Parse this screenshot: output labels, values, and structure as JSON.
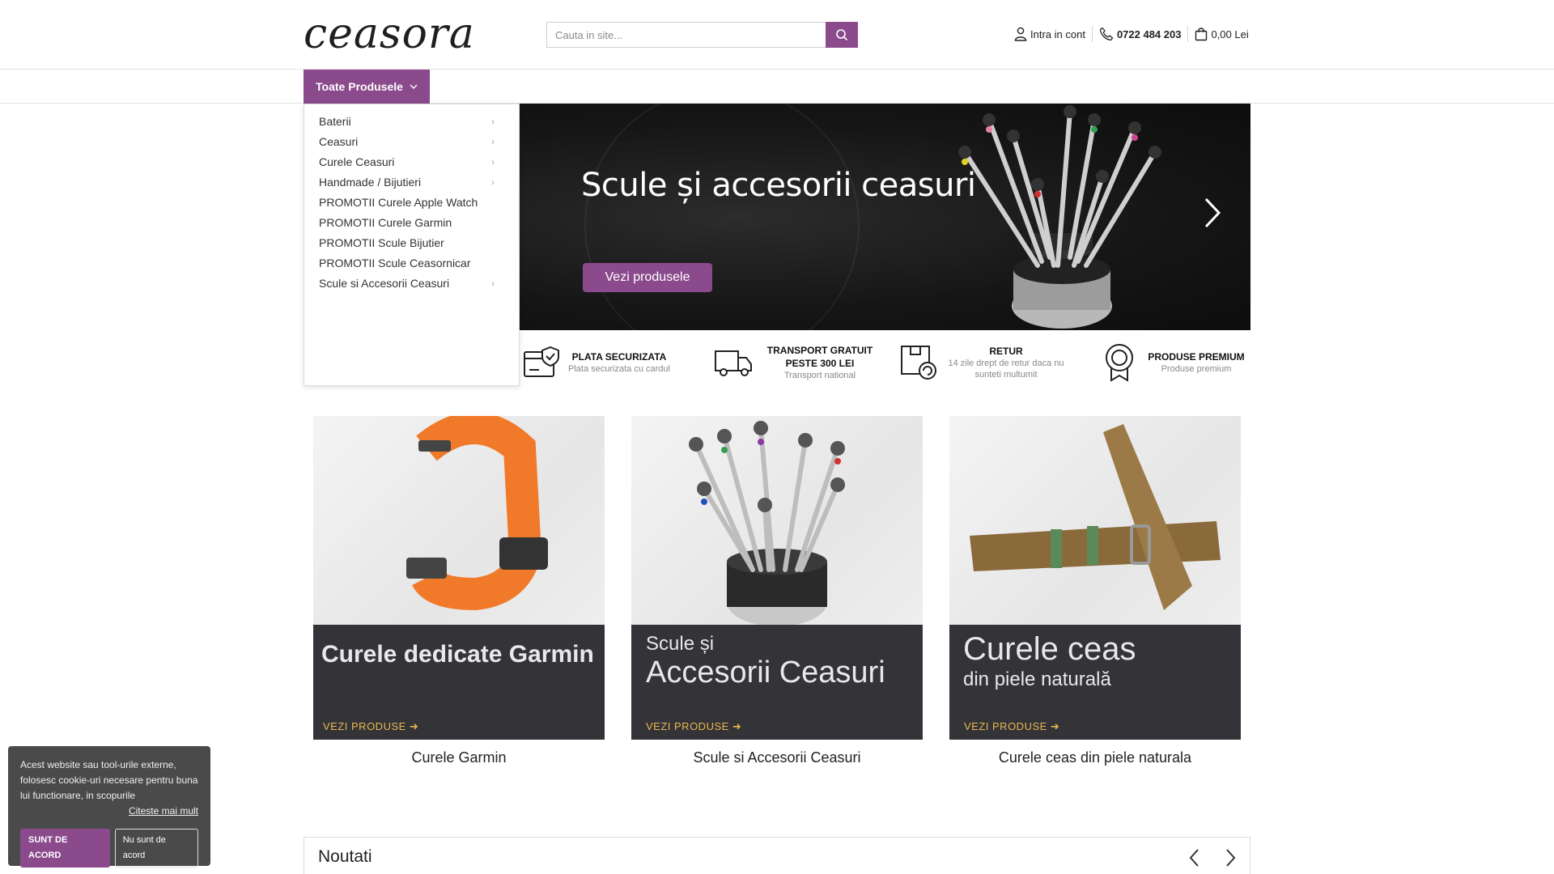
{
  "colors": {
    "accent": "#8a4a8c",
    "link_gold": "#e8b850"
  },
  "header": {
    "logo": "ceasora",
    "search_placeholder": "Cauta in site...",
    "account": "Intra in cont",
    "phone": "0722 484 203",
    "cart": "0,00 Lei"
  },
  "nav": {
    "all_products": "Toate Produsele"
  },
  "menu": [
    {
      "label": "Baterii",
      "has_sub": true
    },
    {
      "label": "Ceasuri",
      "has_sub": true
    },
    {
      "label": "Curele Ceasuri",
      "has_sub": true
    },
    {
      "label": "Handmade / Bijutieri",
      "has_sub": true
    },
    {
      "label": "PROMOTII Curele Apple Watch",
      "has_sub": false
    },
    {
      "label": "PROMOTII Curele Garmin",
      "has_sub": false
    },
    {
      "label": "PROMOTII Scule Bijutier",
      "has_sub": false
    },
    {
      "label": "PROMOTII Scule Ceasornicar",
      "has_sub": false
    },
    {
      "label": "Scule si Accesorii Ceasuri",
      "has_sub": true
    }
  ],
  "hero": {
    "title": "Scule și accesorii ceasuri",
    "button": "Vezi produsele"
  },
  "features": [
    {
      "icon": "secure-payment-icon",
      "title": "PLATA SECURIZATA",
      "sub": "Plata securizata cu cardul"
    },
    {
      "icon": "truck-icon",
      "title": "TRANSPORT GRATUIT PESTE 300 LEI",
      "sub": "Transport national"
    },
    {
      "icon": "return-box-icon",
      "title": "RETUR",
      "sub": "14 zile drept de retur daca nu sunteti multumit"
    },
    {
      "icon": "award-badge-icon",
      "title": "PRODUSE PREMIUM",
      "sub": "Produse premium"
    }
  ],
  "cards": [
    {
      "band_line1": "Curele dedicate Garmin",
      "band_line2": "",
      "link": "VEZI PRODUSE ➜",
      "caption": "Curele Garmin"
    },
    {
      "band_line1": "Scule și",
      "band_line2": "Accesorii Ceasuri",
      "link": "VEZI PRODUSE ➜",
      "caption": "Scule si Accesorii Ceasuri"
    },
    {
      "band_line1": "Curele ceas",
      "band_line2": "din piele naturală",
      "link": "VEZI PRODUSE ➜",
      "caption": "Curele ceas din piele naturala"
    }
  ],
  "noutati": {
    "title": "Noutati"
  },
  "cookie": {
    "text": "Acest website sau tool-urile externe, folosesc cookie-uri necesare pentru buna lui functionare, in scopurile",
    "more": "Citeste mai mult",
    "accept": "SUNT DE ACORD",
    "decline": "Nu sunt de acord"
  }
}
